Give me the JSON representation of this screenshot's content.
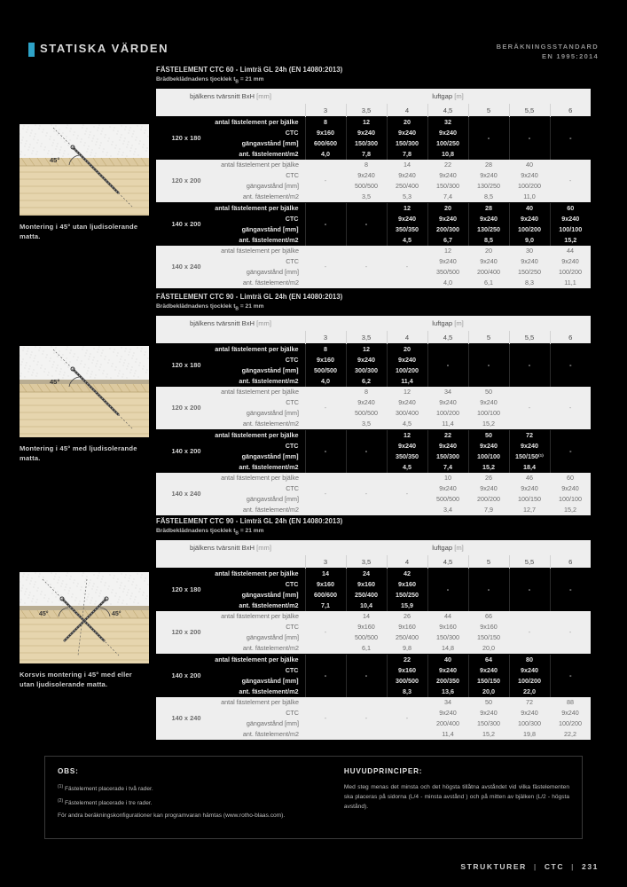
{
  "header": {
    "title": "STATISKA VÄRDEN",
    "standard_line1": "BERÄKNINGSSTANDARD",
    "standard_line2": "EN 1995:2014",
    "accent_color": "#2ea3c8"
  },
  "figures": [
    {
      "angle_label": "45°",
      "caption": "Montering i 45° utan ljudisolerande matta.",
      "type": "single-screw-no-mat"
    },
    {
      "angle_label": "45°",
      "caption": "Montering i 45° med ljudisolerande matta.",
      "type": "single-screw-with-mat"
    },
    {
      "angle_label_left": "45°",
      "angle_label_right": "45°",
      "caption": "Korsvis montering i 45° med eller utan ljudisolerande matta.",
      "type": "crossed-screws"
    }
  ],
  "common": {
    "col_label_header": "bjälkens tvärsnitt BxH",
    "col_label_unit": "[mm]",
    "group_header": "luftgap",
    "group_header_unit": "[m]",
    "columns": [
      "3",
      "3,5",
      "4",
      "4,5",
      "5",
      "5,5",
      "6"
    ],
    "sub_rows": [
      "antal fästelement per bjälke",
      "CTC",
      "gängavstånd [mm]",
      "ant. fästelement/m2"
    ],
    "dash": "-"
  },
  "tables": [
    {
      "title": "FÄSTELEMENT CTC 60 - Limträ GL 24h (EN 14080:2013)",
      "subtitle": "Brädbeklädnadens tjocklek t_B = 21 mm",
      "rows": [
        {
          "label": "120 x 180",
          "highlighted": true,
          "values": [
            [
              "8",
              "9x160",
              "600/600",
              "4,0"
            ],
            [
              "12",
              "9x240",
              "150/300",
              "7,8"
            ],
            [
              "20",
              "9x240",
              "150/300",
              "7,8"
            ],
            [
              "32",
              "9x240",
              "100/250",
              "10,8"
            ],
            [
              "-",
              "",
              "",
              ""
            ],
            [
              "-",
              "",
              "",
              ""
            ],
            [
              "-",
              "",
              "",
              ""
            ]
          ]
        },
        {
          "label": "120 x 200",
          "highlighted": false,
          "values": [
            [
              "-",
              "",
              "",
              ""
            ],
            [
              "8",
              "9x240",
              "500/500",
              "3,5"
            ],
            [
              "14",
              "9x240",
              "250/400",
              "5,3"
            ],
            [
              "22",
              "9x240",
              "150/300",
              "7,4"
            ],
            [
              "28",
              "9x240",
              "130/250",
              "8,5"
            ],
            [
              "40",
              "9x240",
              "100/200",
              "11,0"
            ],
            [
              "-",
              "",
              "",
              ""
            ]
          ]
        },
        {
          "label": "140 x 200",
          "highlighted": true,
          "values": [
            [
              "-",
              "",
              "",
              ""
            ],
            [
              "-",
              "",
              "",
              ""
            ],
            [
              "12",
              "9x240",
              "350/350",
              "4,5"
            ],
            [
              "20",
              "9x240",
              "200/300",
              "6,7"
            ],
            [
              "28",
              "9x240",
              "130/250",
              "8,5"
            ],
            [
              "40",
              "9x240",
              "100/200",
              "9,0"
            ],
            [
              "60",
              "9x240",
              "100/100",
              "15,2"
            ]
          ]
        },
        {
          "label": "140 x 240",
          "highlighted": false,
          "values": [
            [
              "-",
              "",
              "",
              ""
            ],
            [
              "-",
              "",
              "",
              ""
            ],
            [
              "-",
              "",
              "",
              ""
            ],
            [
              "12",
              "9x240",
              "350/500",
              "4,0"
            ],
            [
              "20",
              "9x240",
              "200/400",
              "6,1"
            ],
            [
              "30",
              "9x240",
              "150/250",
              "8,3"
            ],
            [
              "44",
              "9x240",
              "100/200",
              "11,1"
            ]
          ]
        }
      ]
    },
    {
      "title": "FÄSTELEMENT CTC 90 - Limträ GL 24h (EN 14080:2013)",
      "subtitle": "Brädbeklädnadens tjocklek t_B = 21 mm",
      "rows": [
        {
          "label": "120 x 180",
          "highlighted": true,
          "values": [
            [
              "8",
              "9x160",
              "500/500",
              "4,0"
            ],
            [
              "12",
              "9x240",
              "300/300",
              "6,2"
            ],
            [
              "20",
              "9x240",
              "100/200",
              "11,4"
            ],
            [
              "-",
              "",
              "",
              ""
            ],
            [
              "-",
              "",
              "",
              ""
            ],
            [
              "-",
              "",
              "",
              ""
            ],
            [
              "-",
              "",
              "",
              ""
            ]
          ]
        },
        {
          "label": "120 x 200",
          "highlighted": false,
          "values": [
            [
              "-",
              "",
              "",
              ""
            ],
            [
              "8",
              "9x240",
              "500/500",
              "3,5"
            ],
            [
              "12",
              "9x240",
              "300/400",
              "4,5"
            ],
            [
              "34",
              "9x240",
              "100/200",
              "11,4"
            ],
            [
              "50",
              "9x240",
              "100/100",
              "15,2"
            ],
            [
              "-",
              "",
              "",
              ""
            ],
            [
              "-",
              "",
              "",
              ""
            ]
          ]
        },
        {
          "label": "140 x 200",
          "highlighted": true,
          "values": [
            [
              "-",
              "",
              "",
              ""
            ],
            [
              "-",
              "",
              "",
              ""
            ],
            [
              "12",
              "9x240",
              "350/350",
              "4,5"
            ],
            [
              "22",
              "9x240",
              "150/300",
              "7,4"
            ],
            [
              "50",
              "9x240",
              "100/100",
              "15,2"
            ],
            [
              "72",
              "9x240",
              "150/150⁽¹⁾",
              "18,4"
            ],
            [
              "-",
              "",
              "",
              ""
            ]
          ]
        },
        {
          "label": "140 x 240",
          "highlighted": false,
          "values": [
            [
              "-",
              "",
              "",
              ""
            ],
            [
              "-",
              "",
              "",
              ""
            ],
            [
              "-",
              "",
              "",
              ""
            ],
            [
              "10",
              "9x240",
              "500/500",
              "3,4"
            ],
            [
              "26",
              "9x240",
              "200/200",
              "7,9"
            ],
            [
              "46",
              "9x240",
              "100/150",
              "12,7"
            ],
            [
              "60",
              "9x240",
              "100/100",
              "15,2"
            ]
          ]
        }
      ]
    },
    {
      "title": "FÄSTELEMENT CTC 90 - Limträ GL 24h (EN 14080:2013)",
      "subtitle": "Brädbeklädnadens tjocklek t_B = 21 mm",
      "rows": [
        {
          "label": "120 x 180",
          "highlighted": true,
          "values": [
            [
              "14",
              "9x160",
              "600/600",
              "7,1"
            ],
            [
              "24",
              "9x160",
              "250/400",
              "10,4"
            ],
            [
              "42",
              "9x160",
              "150/250",
              "15,9"
            ],
            [
              "-",
              "",
              "",
              ""
            ],
            [
              "-",
              "",
              "",
              ""
            ],
            [
              "-",
              "",
              "",
              ""
            ],
            [
              "-",
              "",
              "",
              ""
            ]
          ]
        },
        {
          "label": "120 x 200",
          "highlighted": false,
          "values": [
            [
              "-",
              "",
              "",
              ""
            ],
            [
              "14",
              "9x160",
              "500/500",
              "6,1"
            ],
            [
              "26",
              "9x160",
              "250/400",
              "9,8"
            ],
            [
              "44",
              "9x160",
              "150/300",
              "14,8"
            ],
            [
              "66",
              "9x160",
              "150/150",
              "20,0"
            ],
            [
              "-",
              "",
              "",
              ""
            ],
            [
              "-",
              "",
              "",
              ""
            ]
          ]
        },
        {
          "label": "140 x 200",
          "highlighted": true,
          "values": [
            [
              "-",
              "",
              "",
              ""
            ],
            [
              "-",
              "",
              "",
              ""
            ],
            [
              "22",
              "9x160",
              "300/500",
              "8,3"
            ],
            [
              "40",
              "9x240",
              "200/350",
              "13,6"
            ],
            [
              "64",
              "9x240",
              "150/150",
              "20,0"
            ],
            [
              "80",
              "9x240",
              "100/200",
              "22,0"
            ],
            [
              "-",
              "",
              "",
              ""
            ]
          ]
        },
        {
          "label": "140 x 240",
          "highlighted": false,
          "values": [
            [
              "-",
              "",
              "",
              ""
            ],
            [
              "-",
              "",
              "",
              ""
            ],
            [
              "-",
              "",
              "",
              ""
            ],
            [
              "34",
              "9x240",
              "200/400",
              "11,4"
            ],
            [
              "50",
              "9x240",
              "150/300",
              "15,2"
            ],
            [
              "72",
              "9x240",
              "100/300",
              "19,8"
            ],
            [
              "88",
              "9x240",
              "100/200",
              "22,2"
            ]
          ]
        }
      ]
    }
  ],
  "notes": {
    "obs_heading": "OBS:",
    "obs_items": [
      {
        "marker": "(1)",
        "text": "Fästelement placerade i två rader."
      },
      {
        "marker": "(2)",
        "text": "Fästelement placerade i tre rader."
      }
    ],
    "obs_paragraph": "För andra beräkningskonfigurationer kan programvaran hämtas (www.rotho-blaas.com).",
    "principles_heading": "HUVUDPRINCIPER:",
    "principles_paragraph": "Med steg menas det minsta och det högsta tillåtna avståndet vid vilka fästelementen ska placeras på sidorna (L/4 - minsta avstånd ) och på mitten av bjälken (L/2 - högsta avstånd)."
  },
  "footer": {
    "section": "STRUKTURER",
    "product": "CTC",
    "page": "231"
  }
}
